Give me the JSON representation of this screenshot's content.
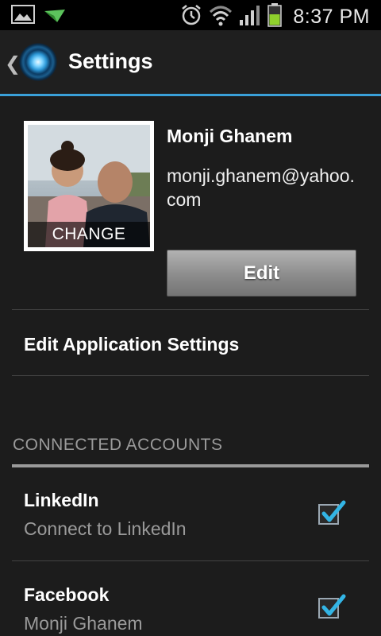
{
  "status_bar": {
    "time": "8:37 PM",
    "icons": [
      "gallery-icon",
      "notification-arrow-icon",
      "alarm-icon",
      "wifi-icon",
      "signal-icon",
      "battery-icon"
    ]
  },
  "action_bar": {
    "title": "Settings",
    "back_glyph": "❮",
    "accent_color": "#3aa0d8"
  },
  "profile": {
    "name": "Monji Ghanem",
    "email": "monji.ghanem@yahoo.com",
    "photo_label": "CHANGE",
    "edit_label": "Edit"
  },
  "menu": {
    "edit_app_settings": "Edit Application Settings"
  },
  "connected_accounts": {
    "header": "CONNECTED ACCOUNTS",
    "items": [
      {
        "title": "LinkedIn",
        "subtitle": "Connect to LinkedIn",
        "checked": true
      },
      {
        "title": "Facebook",
        "subtitle": "Monji Ghanem",
        "checked": true
      }
    ]
  }
}
